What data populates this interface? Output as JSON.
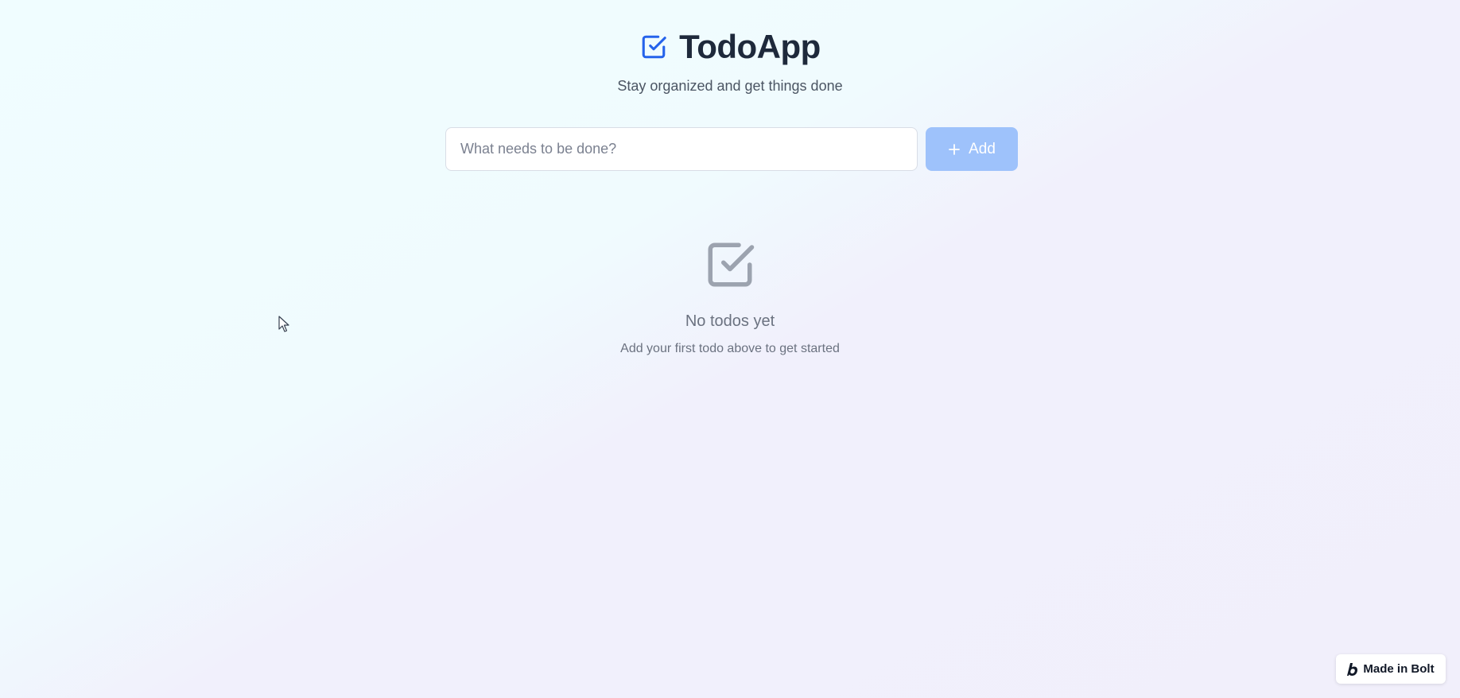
{
  "header": {
    "title": "TodoApp",
    "subtitle": "Stay organized and get things done",
    "icon": "check-square-icon"
  },
  "input": {
    "placeholder": "What needs to be done?",
    "value": ""
  },
  "add_button": {
    "label": "Add",
    "icon": "plus-icon",
    "disabled": true
  },
  "empty_state": {
    "icon": "check-square-icon",
    "title": "No todos yet",
    "subtitle": "Add your first todo above to get started"
  },
  "badge": {
    "label": "Made in Bolt",
    "icon": "bolt-logo-icon"
  },
  "colors": {
    "accent": "#2563eb",
    "button_disabled": "#9ec2fb",
    "muted": "#6b7280"
  }
}
